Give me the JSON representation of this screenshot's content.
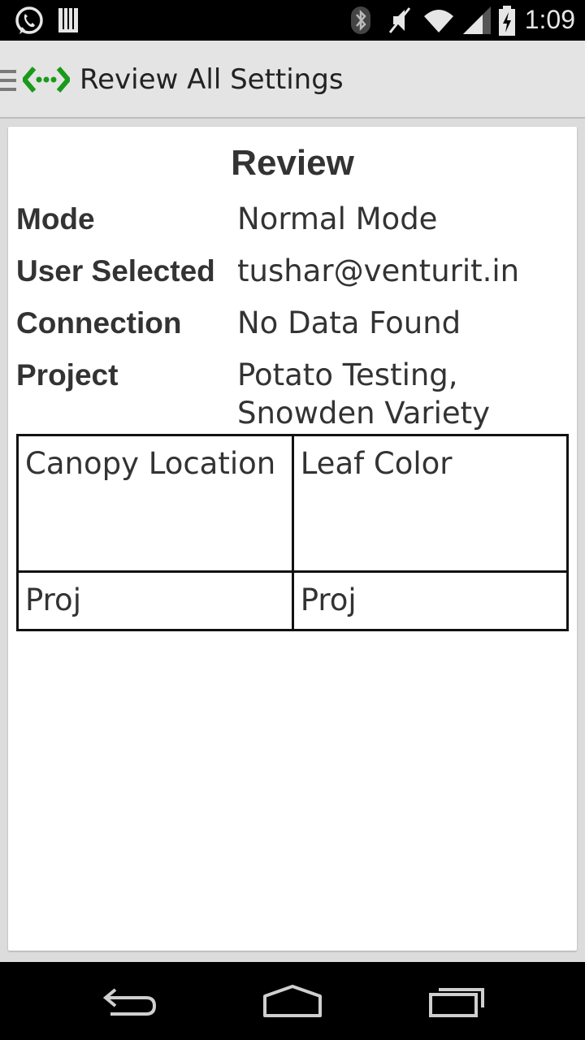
{
  "status_bar": {
    "time": "1:09",
    "icons": [
      "whatsapp-icon",
      "storage-icon",
      "bluetooth-icon",
      "mute-icon",
      "wifi-icon",
      "signal-icon",
      "battery-icon"
    ]
  },
  "action_bar": {
    "title": "Review All Settings",
    "accent_color": "#1a9a1a"
  },
  "review": {
    "heading": "Review",
    "rows": [
      {
        "label": "Mode",
        "value": "Normal Mode"
      },
      {
        "label": "User Selected",
        "value": "tushar@venturit.in"
      },
      {
        "label": "Connection",
        "value": "No Data Found"
      },
      {
        "label": "Project",
        "value": "Potato Testing,\nSnowden Variety"
      }
    ],
    "table": {
      "headers": [
        "Canopy Location",
        "Leaf Color"
      ],
      "rows": [
        [
          "Proj",
          "Proj"
        ]
      ]
    }
  },
  "nav_bar": {
    "buttons": [
      "back-icon",
      "home-icon",
      "recent-apps-icon"
    ]
  }
}
